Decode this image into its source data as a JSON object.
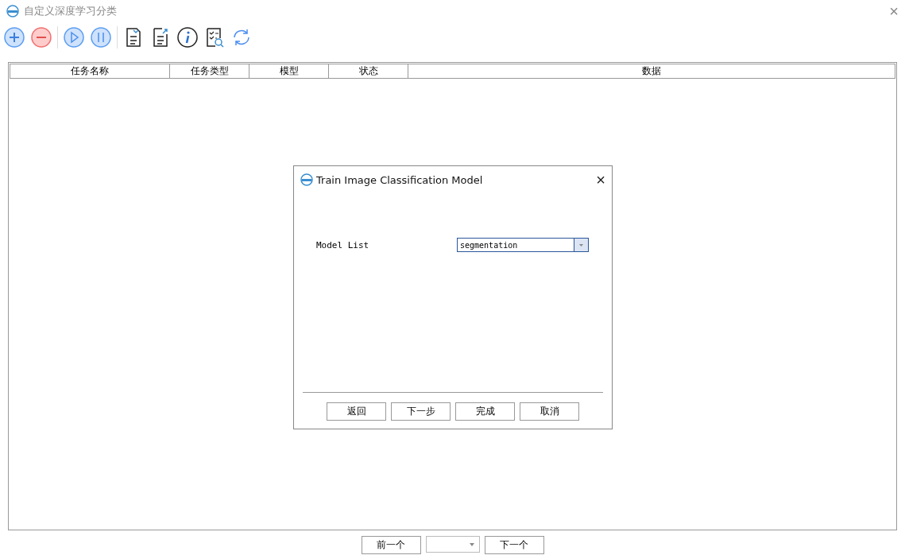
{
  "window": {
    "title": "自定义深度学习分类",
    "close": "×"
  },
  "table": {
    "columns": [
      "任务名称",
      "任务类型",
      "模型",
      "状态",
      "数据"
    ]
  },
  "dialog": {
    "title": "Train Image Classification Model",
    "close": "×",
    "field_label": "Model List",
    "field_value": "segmentation",
    "buttons": [
      "返回",
      "下一步",
      "完成",
      "取消"
    ]
  },
  "pager": {
    "prev": "前一个",
    "next": "下一个"
  }
}
